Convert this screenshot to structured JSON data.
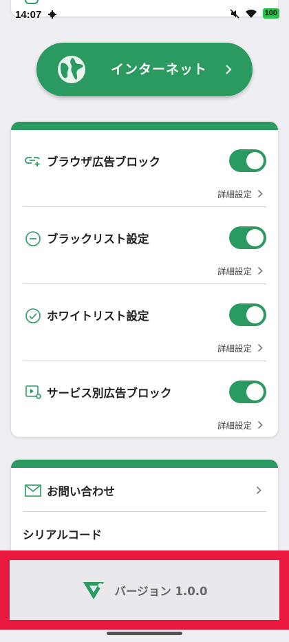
{
  "status_bar": {
    "time": "14:07",
    "battery": "100"
  },
  "internet": {
    "label": "インターネット"
  },
  "features": [
    {
      "label": "ブラウザ広告ブロック",
      "detail": "詳細設定",
      "enabled": true,
      "icon": "link-plus-icon"
    },
    {
      "label": "ブラックリスト設定",
      "detail": "詳細設定",
      "enabled": true,
      "icon": "minus-circle-icon"
    },
    {
      "label": "ホワイトリスト設定",
      "detail": "詳細設定",
      "enabled": true,
      "icon": "check-circle-icon"
    },
    {
      "label": "サービス別広告ブロック",
      "detail": "詳細設定",
      "enabled": true,
      "icon": "video-settings-icon"
    }
  ],
  "support": {
    "contact_label": "お問い合わせ",
    "serial_label": "シリアルコード"
  },
  "version": {
    "label": "バージョン 1.0.0"
  },
  "colors": {
    "accent": "#2b9a61",
    "highlight": "#e8183f",
    "background": "#eeeef3"
  }
}
